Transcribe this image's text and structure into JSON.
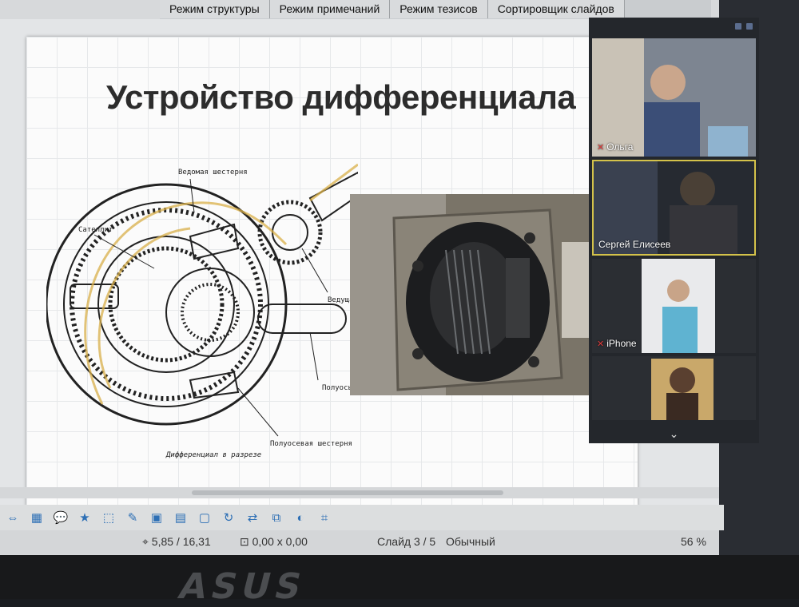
{
  "tabs": [
    "Режим структуры",
    "Режим примечаний",
    "Режим тезисов",
    "Сортировщик слайдов"
  ],
  "slide": {
    "title": "Устройство дифференциала",
    "labels": {
      "drive_gear_top": "Ведомая шестерня",
      "satellite": "Сателлит",
      "drive_gear_right": "Ведущая шестерня",
      "half_shaft": "Полуось",
      "side_gear": "Полуосевая шестерня",
      "caption": "Дифференциал в разрезе"
    }
  },
  "participants": [
    {
      "name": "Ольга",
      "muted": true
    },
    {
      "name": "Сергей Елисеев",
      "muted": false
    },
    {
      "name": "iPhone",
      "muted": true
    },
    {
      "name": "",
      "muted": false
    }
  ],
  "status": {
    "position": "5,85 / 16,31",
    "size": "0,00 x 0,00",
    "slide": "Слайд 3 / 5",
    "layout": "Обычный",
    "zoom": "56 %"
  },
  "toolbar_icons": [
    "arrows-icon",
    "rectangle-icon",
    "callout-icon",
    "star-icon",
    "points-icon",
    "pen-icon",
    "image-icon",
    "chart-icon",
    "movie-icon",
    "rotate-icon",
    "flip-icon",
    "arrange-icon",
    "shadow-icon",
    "crop-icon"
  ],
  "bezel": {
    "brand": "ASUS"
  },
  "colors": {
    "accent": "#2d6fb5",
    "mic_muted": "#e03c3c",
    "panel_bg": "#24272c"
  }
}
